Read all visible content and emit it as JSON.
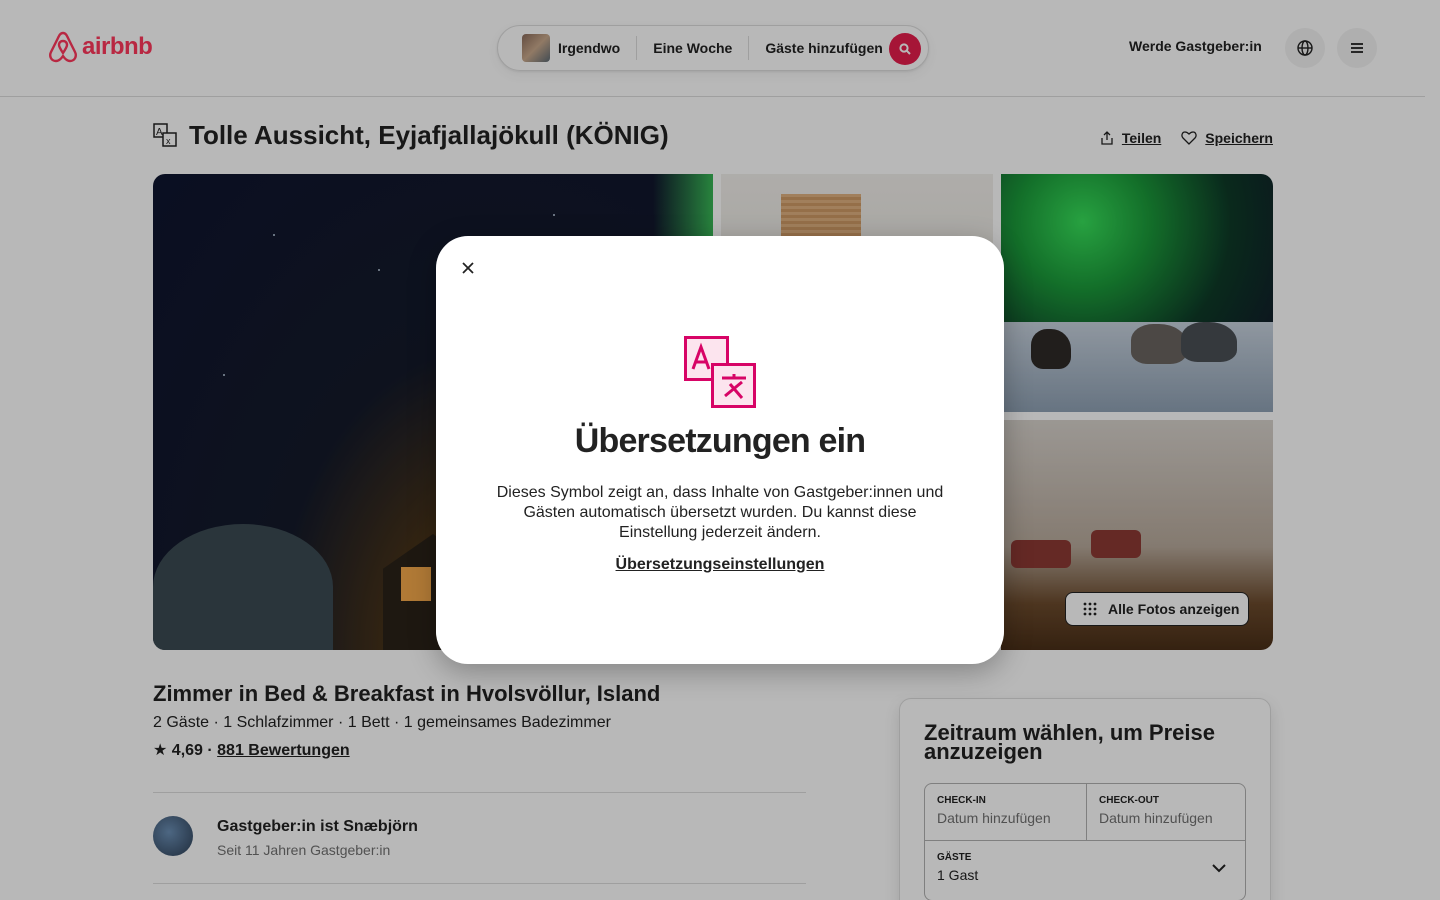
{
  "header": {
    "logo_text": "airbnb",
    "search": {
      "location": "Irgendwo",
      "dates": "Eine Woche",
      "guests": "Gäste hinzufügen"
    },
    "host_link": "Werde Gastgeber:in"
  },
  "listing": {
    "title": "Tolle Aussicht, Eyjafjallajökull (KÖNIG)",
    "share_label": "Teilen",
    "save_label": "Speichern",
    "all_photos_label": "Alle Fotos anzeigen",
    "subtitle": "Zimmer in Bed & Breakfast in Hvolsvöllur, Island",
    "meta": "2 Gäste · 1 Schlafzimmer · 1 Bett · 1 gemeinsames Badezimmer",
    "rating_value": "★ 4,69 ·",
    "reviews_link": "881 Bewertungen"
  },
  "host": {
    "name": "Gastgeber:in ist Snæbjörn",
    "since": "Seit 11 Jahren Gastgeber:in"
  },
  "booking": {
    "title": "Zeitraum wählen, um Preise anzuzeigen",
    "checkin_label": "Check-in",
    "checkin_value": "Datum hinzufügen",
    "checkout_label": "Check-out",
    "checkout_value": "Datum hinzufügen",
    "guests_label": "Gäste",
    "guests_value": "1 Gast"
  },
  "modal": {
    "title": "Übersetzungen ein",
    "text": "Dieses Symbol zeigt an, dass Inhalte von Gastgeber:innen und Gästen automatisch übersetzt wurden. Du kannst diese Einstellung jederzeit ändern.",
    "link": "Übersetzungseinstellungen"
  },
  "colors": {
    "brand": "#FF385C",
    "search_button": "#E61E4D",
    "translate_icon": "#D70466"
  }
}
